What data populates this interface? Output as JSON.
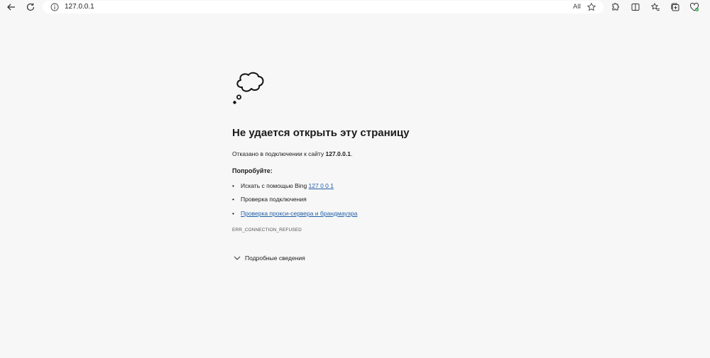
{
  "toolbar": {
    "url": "127.0.0.1",
    "read_aloud": "Aʬ",
    "back_icon": "arrow-left-icon",
    "reload_icon": "reload-icon",
    "info_icon": "info-icon",
    "favorite_icon": "star-icon",
    "right_icons": [
      "extensions-icon",
      "split-screen-icon",
      "favorites-icon",
      "collections-icon",
      "performance-icon"
    ]
  },
  "error": {
    "icon": "thought-cloud-icon",
    "title": "Не удается открыть эту страницу",
    "refused_prefix": "Отказано в подключении к сайту ",
    "refused_host": "127.0.0.1",
    "refused_suffix": ".",
    "try_label": "Попробуйте:",
    "suggestions": [
      {
        "prefix": "Искать с помощью Bing ",
        "link": "127 0 0 1"
      },
      {
        "prefix": "Проверка подключения",
        "link": ""
      },
      {
        "prefix": "",
        "link": "Проверка прокси-сервера и брандмауэра"
      }
    ],
    "code": "ERR_CONNECTION_REFUSED",
    "details_label": "Подробные сведения"
  },
  "colors": {
    "background": "#f7f7f7",
    "link": "#1f5fa6",
    "text": "#1b1b1b"
  }
}
